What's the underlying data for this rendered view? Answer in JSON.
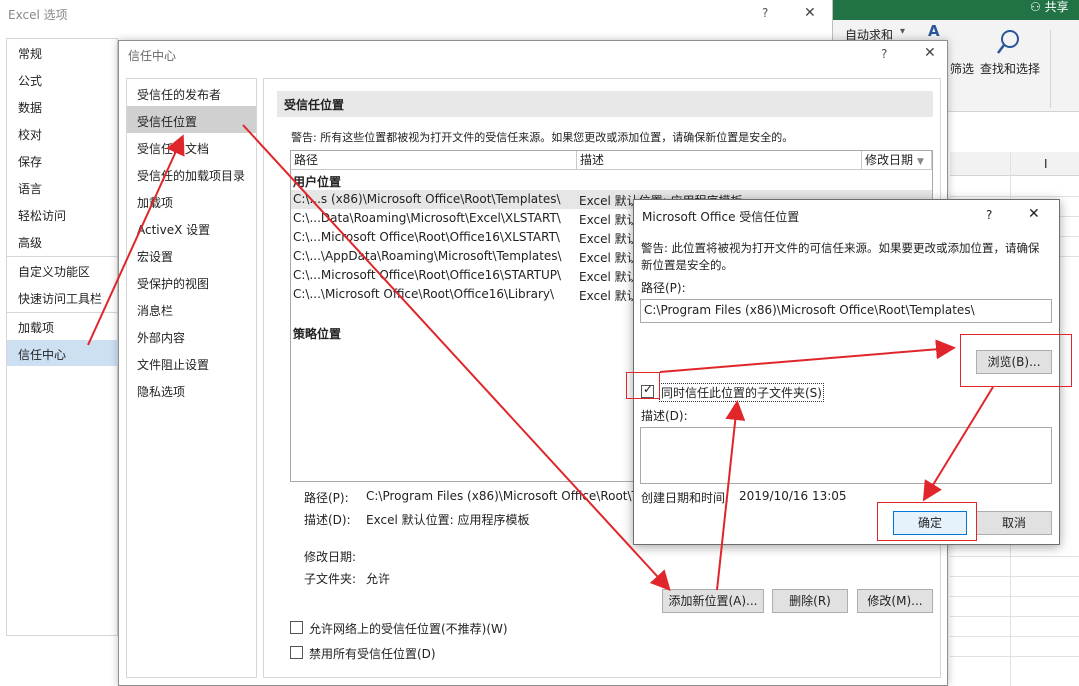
{
  "excel": {
    "share_label": "共享",
    "autosum_label": "自动求和",
    "filter_label": "筛选",
    "find_select_label": "查找和选择",
    "column_header": "I"
  },
  "options_dialog": {
    "title": "Excel 选项",
    "help": "?",
    "close": "✕",
    "nav": [
      "常规",
      "公式",
      "数据",
      "校对",
      "保存",
      "语言",
      "轻松访问",
      "高级",
      "自定义功能区",
      "快速访问工具栏",
      "加载项",
      "信任中心"
    ],
    "selected": "信任中心"
  },
  "trust_center": {
    "title": "信任中心",
    "help": "?",
    "close": "✕",
    "nav": [
      "受信任的发布者",
      "受信任位置",
      "受信任的文档",
      "受信任的加载项目录",
      "加载项",
      "ActiveX 设置",
      "宏设置",
      "受保护的视图",
      "消息栏",
      "外部内容",
      "文件阻止设置",
      "隐私选项"
    ],
    "selected": "受信任位置",
    "section_title": "受信任位置",
    "warning": "警告: 所有这些位置都被视为打开文件的受信任来源。如果您更改或添加位置，请确保新位置是安全的。",
    "columns": [
      "路径",
      "描述",
      "修改日期"
    ],
    "user_group": "用户位置",
    "rows": [
      {
        "path": "C:\\...s (x86)\\Microsoft Office\\Root\\Templates\\",
        "desc": "Excel 默认位置: 应用程序模板"
      },
      {
        "path": "C:\\...Data\\Roaming\\Microsoft\\Excel\\XLSTART\\",
        "desc": "Excel 默认"
      },
      {
        "path": "C:\\...Microsoft Office\\Root\\Office16\\XLSTART\\",
        "desc": "Excel 默认"
      },
      {
        "path": "C:\\...\\AppData\\Roaming\\Microsoft\\Templates\\",
        "desc": "Excel 默认"
      },
      {
        "path": "C:\\...Microsoft Office\\Root\\Office16\\STARTUP\\",
        "desc": "Excel 默认"
      },
      {
        "path": "C:\\...\\Microsoft Office\\Root\\Office16\\Library\\",
        "desc": "Excel 默认"
      }
    ],
    "policy_group": "策略位置",
    "detail": {
      "path_label": "路径(P):",
      "path_value": "C:\\Program Files (x86)\\Microsoft Office\\Root\\T",
      "desc_label": "描述(D):",
      "desc_value": "Excel 默认位置: 应用程序模板",
      "modified_label": "修改日期:",
      "subfolder_label": "子文件夹:",
      "subfolder_value": "允许"
    },
    "buttons": {
      "add": "添加新位置(A)...",
      "remove": "删除(R)",
      "modify": "修改(M)..."
    },
    "allow_network": "允许网络上的受信任位置(不推荐)(W)",
    "disable_all": "禁用所有受信任位置(D)"
  },
  "modal": {
    "title": "Microsoft Office 受信任位置",
    "help": "?",
    "close": "✕",
    "warning": "警告: 此位置将被视为打开文件的可信任来源。如果要更改或添加位置，请确保新位置是安全的。",
    "path_label": "路径(P):",
    "path_value": "C:\\Program Files (x86)\\Microsoft Office\\Root\\Templates\\",
    "browse": "浏览(B)...",
    "subfolders_label": "同时信任此位置的子文件夹(S)",
    "subfolders_checked": true,
    "desc_label": "描述(D):",
    "desc_value": "",
    "created_label": "创建日期和时间:",
    "created_value": "2019/10/16 13:05",
    "ok": "确定",
    "cancel": "取消"
  },
  "colors": {
    "annotation": "#e0262b",
    "excel_green": "#217346",
    "selection": "#cde0f2"
  }
}
